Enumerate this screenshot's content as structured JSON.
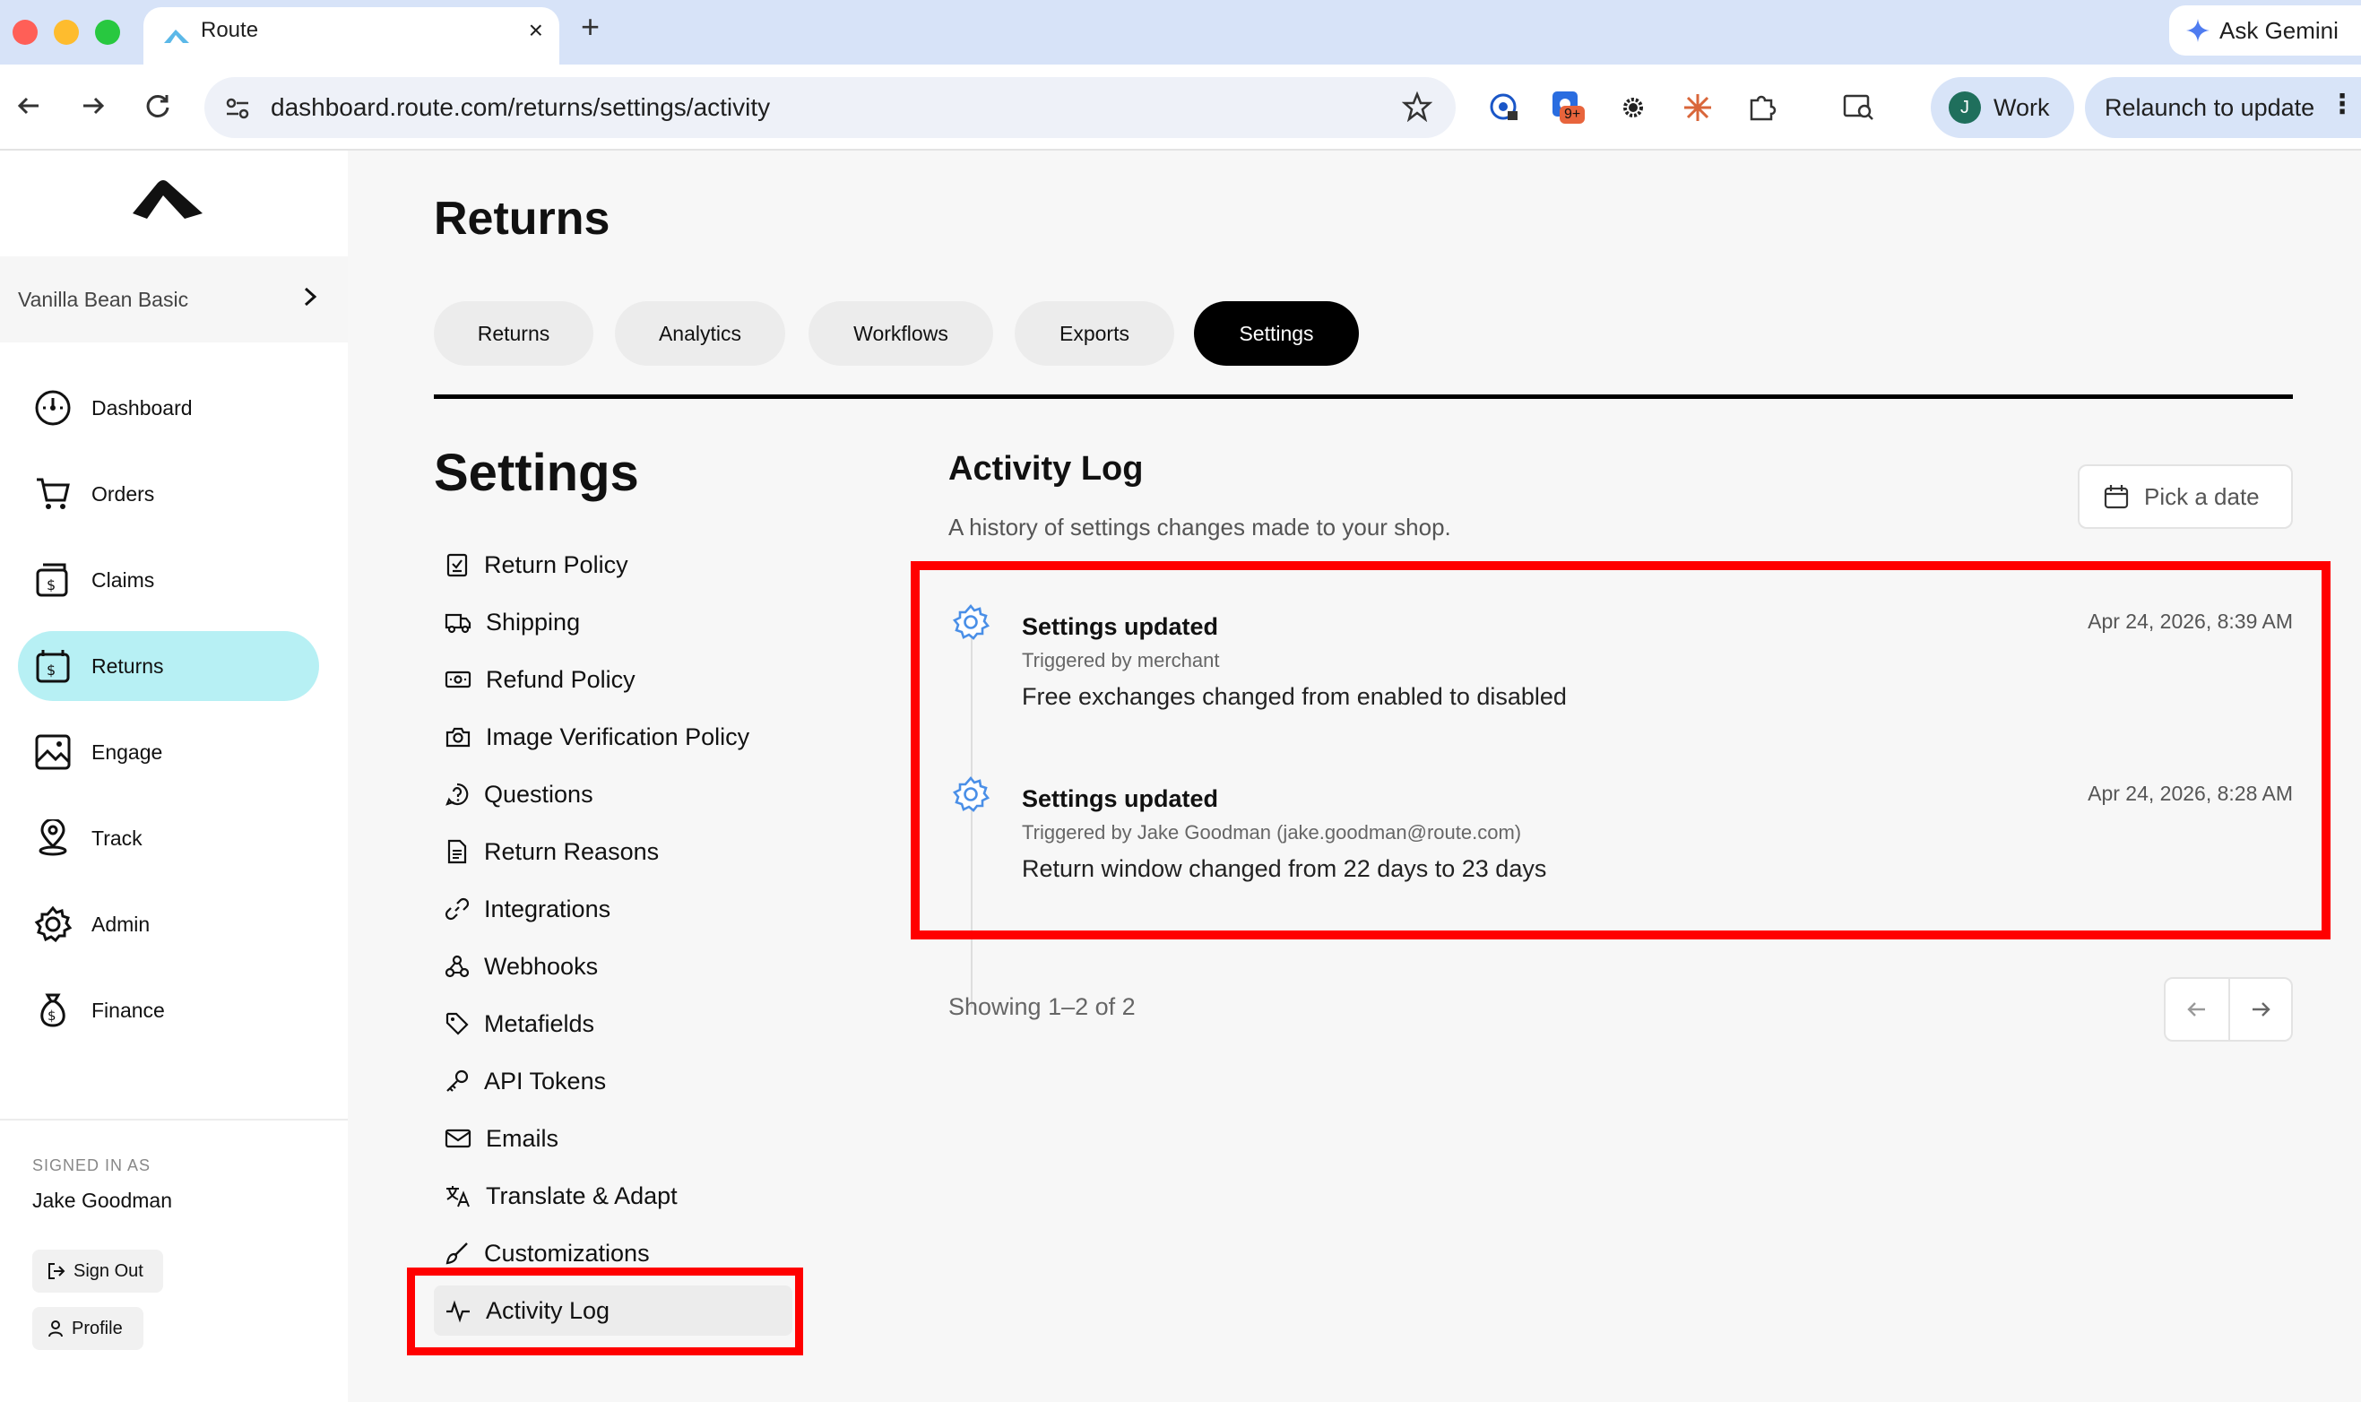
{
  "browser": {
    "tab_title": "Route",
    "url": "dashboard.route.com/returns/settings/activity",
    "ask_gemini": "Ask Gemini",
    "profile_label": "Work",
    "profile_initial": "J",
    "relaunch_label": "Relaunch to update",
    "ext_badge": "9+"
  },
  "sidebar": {
    "shop_name": "Vanilla Bean Basic",
    "items": [
      {
        "label": "Dashboard",
        "icon": "dashboard-icon"
      },
      {
        "label": "Orders",
        "icon": "cart-icon"
      },
      {
        "label": "Claims",
        "icon": "claims-icon"
      },
      {
        "label": "Returns",
        "icon": "returns-icon",
        "active": true
      },
      {
        "label": "Engage",
        "icon": "image-icon"
      },
      {
        "label": "Track",
        "icon": "location-pin-icon"
      },
      {
        "label": "Admin",
        "icon": "gear-icon"
      },
      {
        "label": "Finance",
        "icon": "money-bag-icon"
      }
    ],
    "signed_in_label": "SIGNED IN AS",
    "user_name": "Jake Goodman",
    "sign_out_label": "Sign Out",
    "profile_label": "Profile"
  },
  "main": {
    "title": "Returns",
    "tabs": [
      {
        "label": "Returns"
      },
      {
        "label": "Analytics"
      },
      {
        "label": "Workflows"
      },
      {
        "label": "Exports"
      },
      {
        "label": "Settings",
        "active": true
      }
    ],
    "settings_title": "Settings",
    "settings_nav": [
      {
        "label": "Return Policy",
        "icon": "checklist-icon"
      },
      {
        "label": "Shipping",
        "icon": "truck-icon"
      },
      {
        "label": "Refund Policy",
        "icon": "banknote-icon"
      },
      {
        "label": "Image Verification Policy",
        "icon": "camera-icon"
      },
      {
        "label": "Questions",
        "icon": "question-icon"
      },
      {
        "label": "Return Reasons",
        "icon": "document-icon"
      },
      {
        "label": "Integrations",
        "icon": "link-icon"
      },
      {
        "label": "Webhooks",
        "icon": "webhook-icon"
      },
      {
        "label": "Metafields",
        "icon": "tag-icon"
      },
      {
        "label": "API Tokens",
        "icon": "key-icon"
      },
      {
        "label": "Emails",
        "icon": "mail-icon"
      },
      {
        "label": "Translate & Adapt",
        "icon": "translate-icon"
      },
      {
        "label": "Customizations",
        "icon": "brush-icon"
      },
      {
        "label": "Activity Log",
        "icon": "activity-icon",
        "active": true
      }
    ],
    "activity": {
      "title": "Activity Log",
      "subtitle": "A history of settings changes made to your shop.",
      "date_picker_label": "Pick a date",
      "entries": [
        {
          "title": "Settings updated",
          "triggered_by": "Triggered by merchant",
          "description": "Free exchanges changed from enabled to disabled",
          "timestamp": "Apr 24, 2026, 8:39 AM"
        },
        {
          "title": "Settings updated",
          "triggered_by": "Triggered by Jake Goodman (jake.goodman@route.com)",
          "description": "Return window changed from 22 days to 23 days",
          "timestamp": "Apr 24, 2026, 8:28 AM"
        }
      ],
      "showing_text": "Showing 1–2 of 2"
    }
  },
  "colors": {
    "active_nav": "#b7f0f4",
    "highlight_box": "#ff0000",
    "entry_icon": "#4a8fe7"
  }
}
